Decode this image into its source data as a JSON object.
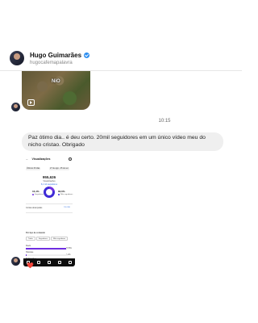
{
  "contact": {
    "name": "Hugo Guimarães",
    "handle": "hugocafemapalavra",
    "verified_icon": "verified-badge-icon"
  },
  "shared_media": {
    "overlay_text": "NiO",
    "icon": "reel-icon"
  },
  "timestamp": "10:15",
  "message": {
    "text": "Paz ótimo dia..  é deu certo.  20mil seguidores em um único vídeo meu do nicho cristao.  Obrigado"
  },
  "insights_screenshot": {
    "title": "Visualizações",
    "chips": [
      "Últimos 30 dias",
      "27 de ago - 25 de set"
    ],
    "total_views": "955,626",
    "total_label": "Visualizações",
    "total_note": "6,1 mil seguidores",
    "followers_pct": "16,4%",
    "followers_label": "Seguidores",
    "nonfollowers_pct": "83,6%",
    "nonfollowers_label": "Não seguidores",
    "accounts_label": "Contas alcançadas",
    "accounts_value": "701.390",
    "by_type_label": "Por tipo de conteúdo",
    "tabs": [
      "Todos",
      "Seguidores",
      "Não seguidores"
    ],
    "rows": [
      {
        "label": "Reels",
        "value": "97,8%",
        "fill": 0.978
      },
      {
        "label": "Histórias",
        "value": "1,2%",
        "fill": 0.012
      },
      {
        "label": "Publicações",
        "value": "",
        "fill": 0.0
      }
    ],
    "colors": {
      "followers": "#6f2ee0",
      "nonfollowers": "#3f2bd6"
    }
  },
  "reaction": "❤️"
}
